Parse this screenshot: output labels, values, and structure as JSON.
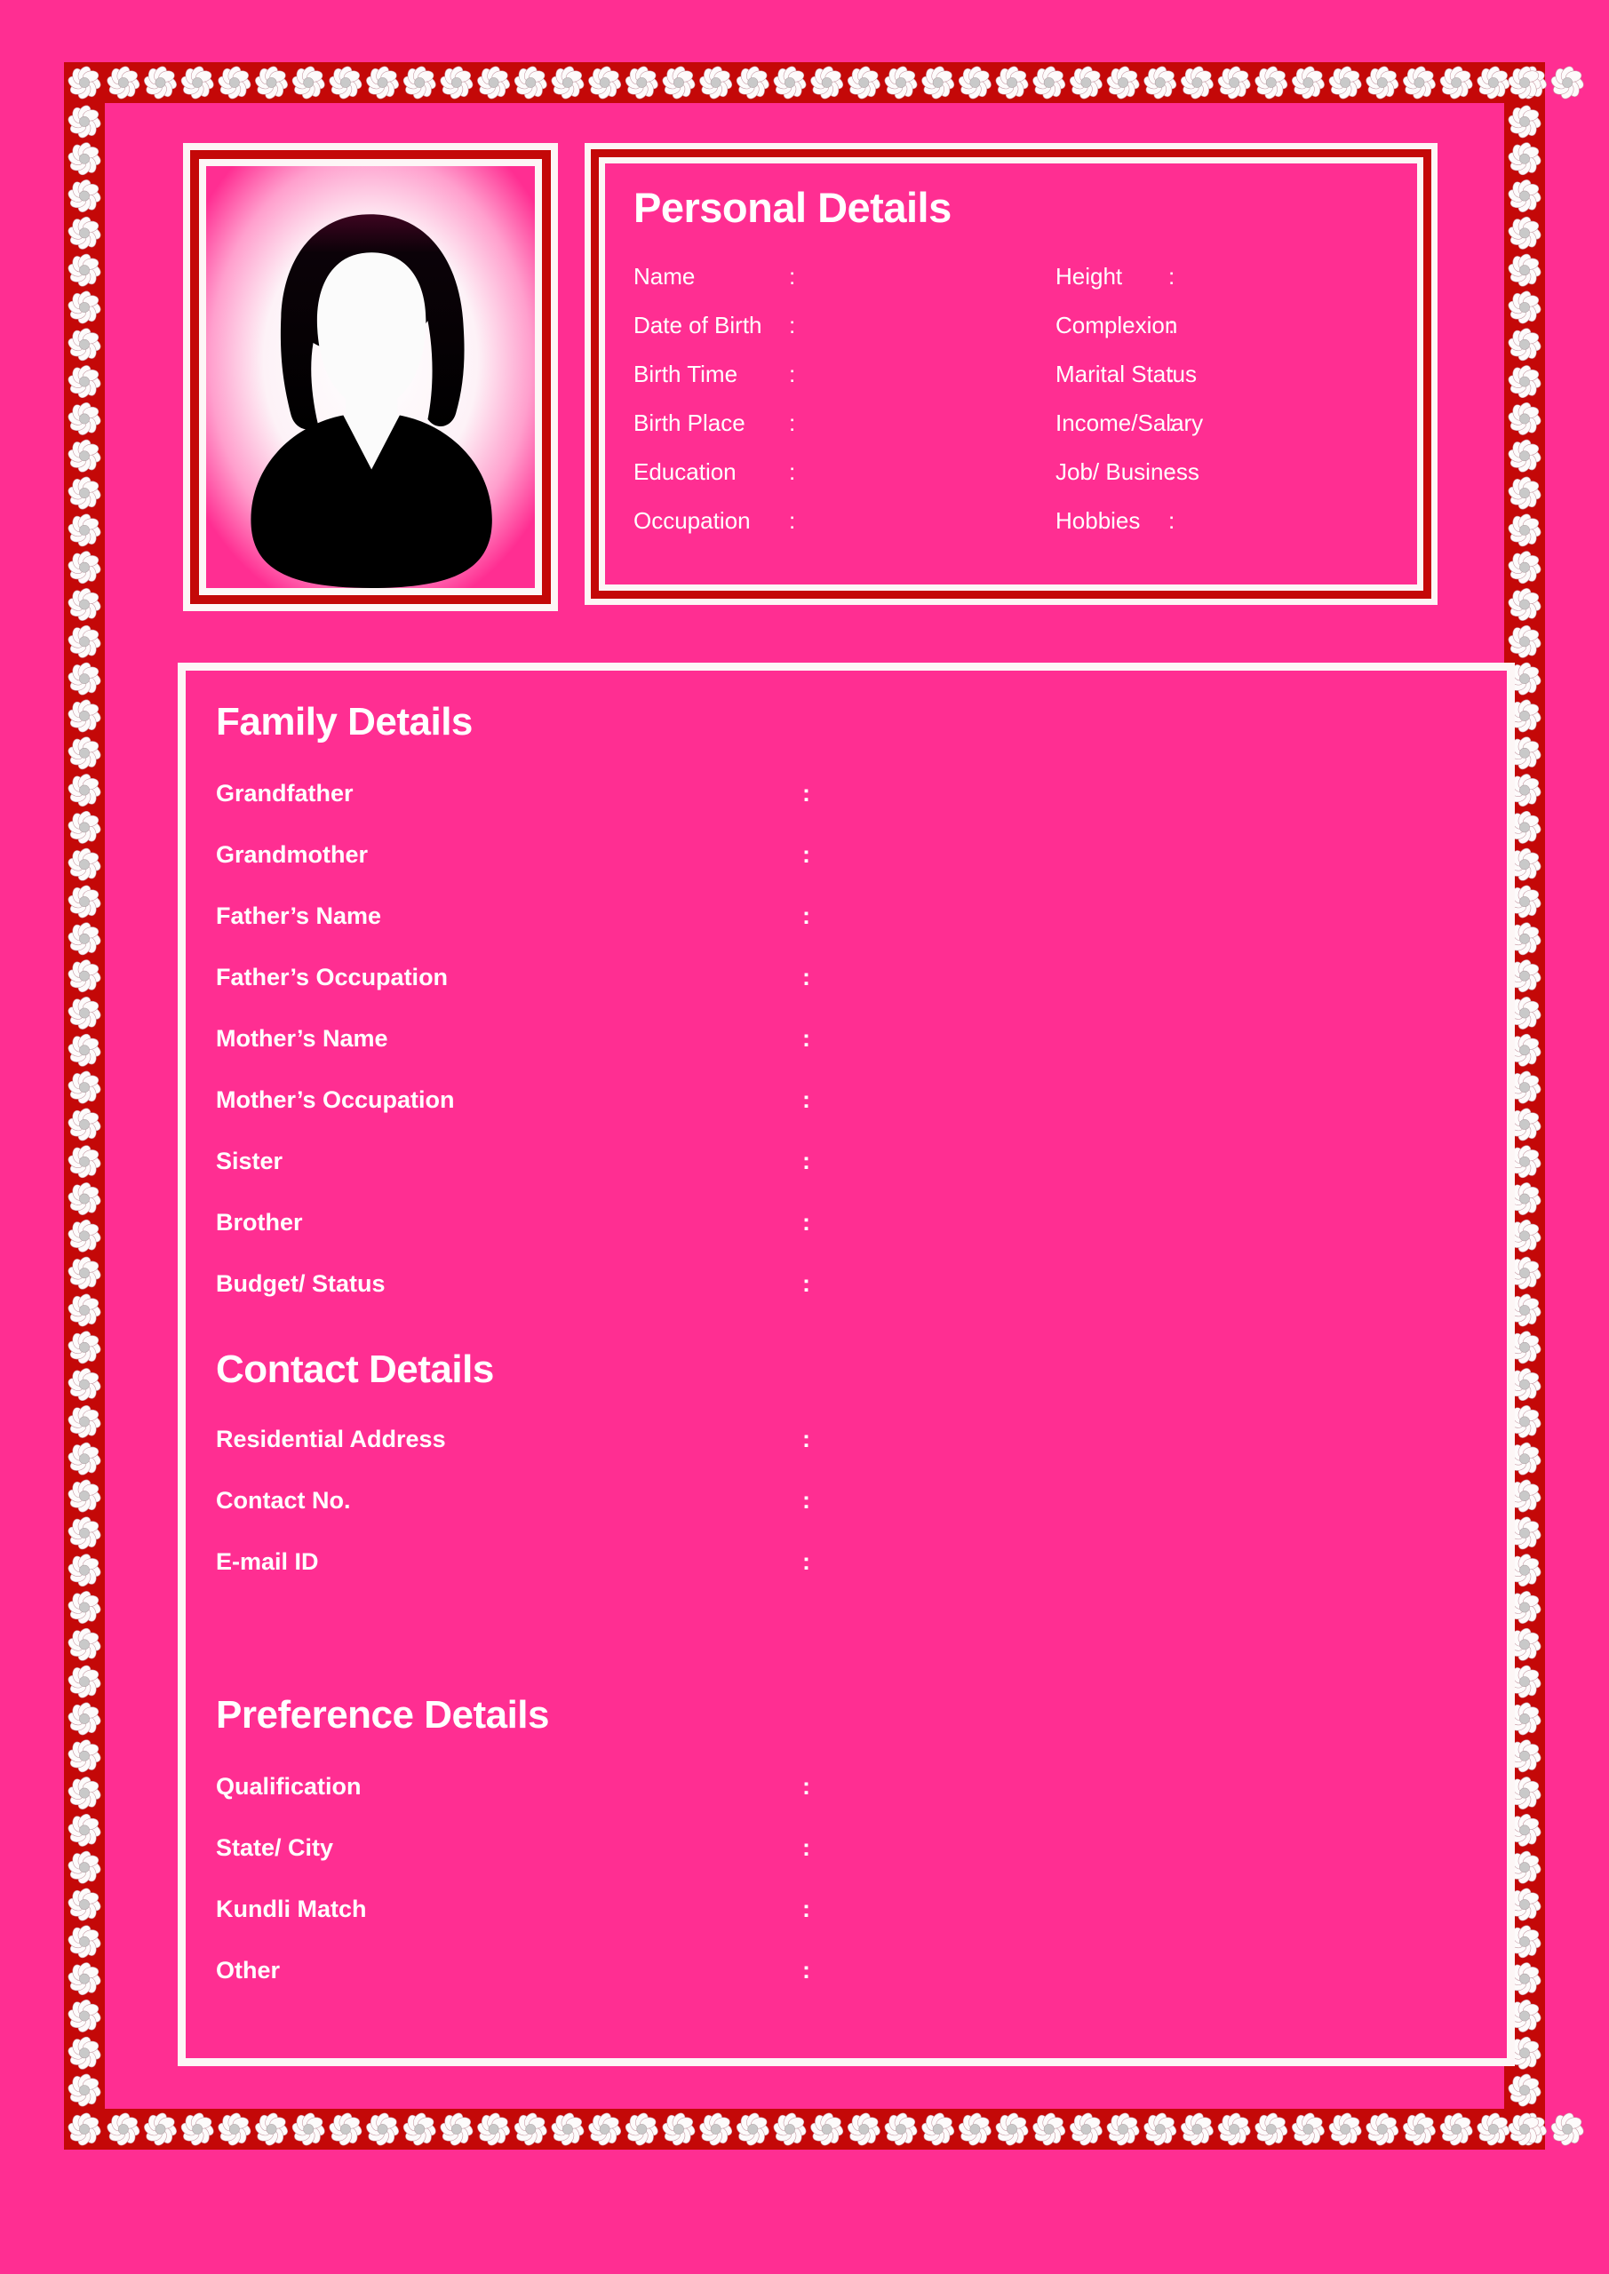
{
  "theme": {
    "pink": "#ff2e92",
    "dark_red": "#c40808",
    "white": "#fdf6f6",
    "text": "#ffffff"
  },
  "photo": {
    "placeholder_icon": "female-silhouette-avatar-icon"
  },
  "personal": {
    "heading": "Personal Details",
    "colon": ":",
    "rows": [
      {
        "left_label": "Name",
        "left_value": "",
        "right_label": "Height",
        "right_value": ""
      },
      {
        "left_label": "Date of Birth",
        "left_value": "",
        "right_label": "Complexion",
        "right_value": ""
      },
      {
        "left_label": "Birth Time",
        "left_value": "",
        "right_label": "Marital Status",
        "right_value": ""
      },
      {
        "left_label": "Birth Place",
        "left_value": "",
        "right_label": "Income/Salary",
        "right_value": ""
      },
      {
        "left_label": "Education",
        "left_value": "",
        "right_label": "Job/ Business",
        "right_value": ""
      },
      {
        "left_label": "Occupation",
        "left_value": "",
        "right_label": "Hobbies",
        "right_value": ""
      }
    ]
  },
  "family": {
    "heading": "Family Details",
    "colon": ":",
    "rows": [
      {
        "label": "Grandfather",
        "value": ""
      },
      {
        "label": "Grandmother",
        "value": ""
      },
      {
        "label": "Father’s Name",
        "value": ""
      },
      {
        "label": "Father’s Occupation",
        "value": ""
      },
      {
        "label": "Mother’s Name",
        "value": ""
      },
      {
        "label": "Mother’s Occupation",
        "value": ""
      },
      {
        "label": "Sister",
        "value": ""
      },
      {
        "label": "Brother",
        "value": ""
      },
      {
        "label": "Budget/ Status",
        "value": ""
      }
    ]
  },
  "contact": {
    "heading": "Contact Details",
    "colon": ":",
    "rows": [
      {
        "label": "Residential Address",
        "value": ""
      },
      {
        "label": "Contact No.",
        "value": ""
      },
      {
        "label": "E-mail ID",
        "value": ""
      }
    ]
  },
  "preference": {
    "heading": "Preference Details",
    "colon": ":",
    "rows": [
      {
        "label": "Qualification",
        "value": ""
      },
      {
        "label": "State/ City",
        "value": ""
      },
      {
        "label": "Kundli Match",
        "value": ""
      },
      {
        "label": "Other",
        "value": ""
      }
    ]
  },
  "decoration": {
    "border_icon": "flower-rosette-icon",
    "petal_count": 8
  }
}
